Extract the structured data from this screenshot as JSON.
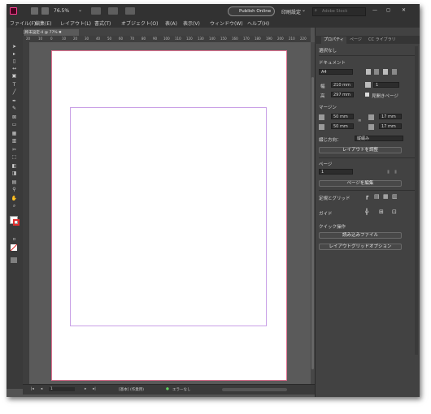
{
  "titlebar": {
    "zoom": "76.5%",
    "publish_label": "Publish Online",
    "workspace_label": "印刷設定",
    "search_placeholder": "Adobe Stock",
    "minimize": "—",
    "maximize": "◻",
    "close": "✕"
  },
  "menu": [
    "ファイル(F)",
    "編集(E)",
    "レイアウト(L)",
    "書式(T)",
    "オブジェクト(O)",
    "表(A)",
    "表示(V)",
    "ウィンドウ(W)",
    "ヘルプ(H)"
  ],
  "document_tab": "*名称未設定-4 @ 77% ✖",
  "ruler_ticks": [
    "20",
    "10",
    "0",
    "10",
    "20",
    "30",
    "40",
    "50",
    "60",
    "70",
    "80",
    "90",
    "100",
    "110",
    "120",
    "130",
    "140",
    "150",
    "160",
    "170",
    "180",
    "190",
    "200",
    "210",
    "220"
  ],
  "status": {
    "page": "1",
    "style": "[基本] (作業用)",
    "errors": "エラーなし"
  },
  "panel": {
    "tabs": [
      "プロパティ",
      "ページ",
      "CC ライブラリ"
    ],
    "selection": "選択なし",
    "document_heading": "ドキュメント",
    "page_size": "A4",
    "width_label": "幅",
    "width": "210 mm",
    "height_label": "高",
    "height": "297 mm",
    "pages_value": "1",
    "facing_label": "見開きページ",
    "margin_heading": "マージン",
    "margin_top": "50 mm",
    "margin_bottom": "50 mm",
    "margin_left": "17 mm",
    "margin_right": "17 mm",
    "binding_label": "綴じ方向：",
    "binding_value": "縦綴み",
    "adjust_layout_btn": "レイアウトを調整",
    "page_heading": "ページ",
    "page_value": "1",
    "edit_page_btn": "ページを編集",
    "ruler_grid_heading": "定規とグリッド",
    "guide_heading": "ガイド",
    "quick_actions_heading": "クイック操作",
    "import_file_btn": "読み込みファイル",
    "layout_grid_btn": "レイアウトグリッドオプション"
  },
  "colors": {
    "chrome": "#323232",
    "workspace": "#535353",
    "panel": "#424242",
    "margin_guide": "#c9a0e6",
    "bleed": "#e07090"
  }
}
